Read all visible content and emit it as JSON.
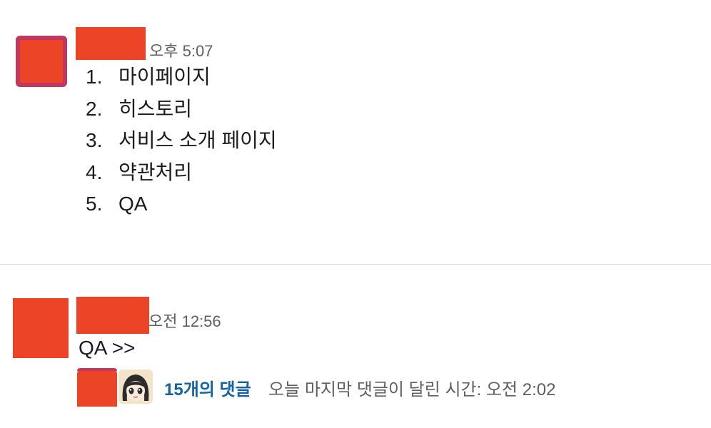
{
  "colors": {
    "redaction": "#eb4426",
    "avatar_border": "#c0385f",
    "link": "#1264a3",
    "muted": "#616061"
  },
  "message1": {
    "timestamp": "오후 5:07",
    "items": [
      {
        "num": "1.",
        "text": "마이페이지"
      },
      {
        "num": "2.",
        "text": "히스토리"
      },
      {
        "num": "3.",
        "text": "서비스 소개 페이지"
      },
      {
        "num": "4.",
        "text": "약관처리"
      },
      {
        "num": "5.",
        "text": "QA"
      }
    ]
  },
  "message2": {
    "timestamp": "오전 12:56",
    "text": "QA >>",
    "thread": {
      "reply_count": "15개의 댓글",
      "last_reply": "오늘 마지막 댓글이 달린 시간: 오전 2:02"
    }
  }
}
